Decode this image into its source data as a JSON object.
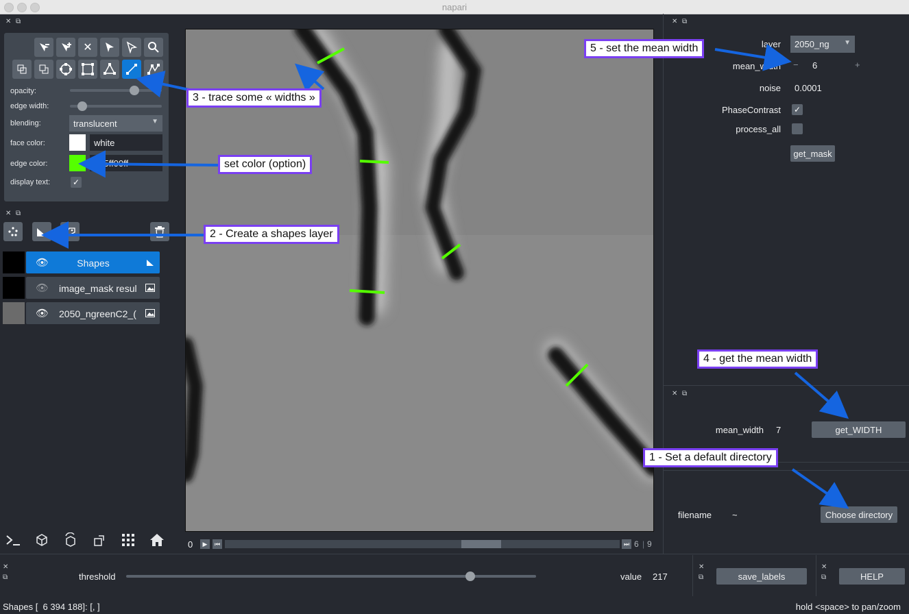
{
  "window": {
    "title": "napari"
  },
  "layer_controls": {
    "opacity_label": "opacity:",
    "edge_width_label": "edge width:",
    "blending_label": "blending:",
    "blending_value": "translucent",
    "face_color_label": "face color:",
    "face_color_value": "white",
    "edge_color_label": "edge color:",
    "edge_color_value": "#55ff00ff",
    "display_text_label": "display text:",
    "opacity": 0.7,
    "edge_width": 0.08
  },
  "layers": [
    {
      "name": "Shapes",
      "visible": true,
      "selected": true,
      "icon": "shapes-icon"
    },
    {
      "name": "image_mask resul",
      "visible": false,
      "selected": false,
      "icon": "image-icon"
    },
    {
      "name": "2050_ngreenC2_(",
      "visible": true,
      "selected": false,
      "icon": "image-icon"
    }
  ],
  "viewer": {
    "slider_start": "0",
    "slider_current": "6",
    "slider_max": "9"
  },
  "get_mask_widget": {
    "layer_label": "layer",
    "layer_value": "2050_ng",
    "mean_width_label": "mean_width",
    "mean_width_value": "6",
    "minus": "−",
    "plus": "+",
    "noise_label": "noise",
    "noise_value": "0.0001",
    "phase_label": "PhaseContrast",
    "process_all_label": "process_all",
    "button": "get_mask"
  },
  "width_widget": {
    "label": "mean_width",
    "value": "7",
    "button": "get_WIDTH"
  },
  "dir_widget": {
    "label": "filename",
    "value": "~",
    "button": "Choose directory"
  },
  "bottom": {
    "threshold_label": "threshold",
    "threshold_fraction": 0.84,
    "value_label": "value",
    "value": "217",
    "save_button": "save_labels",
    "help_button": "HELP"
  },
  "status": {
    "left": "Shapes [  6 394 188]: [, ]",
    "right": "hold <space> to pan/zoom"
  },
  "annotations": {
    "a1": "1 - Set a default directory",
    "a2": "2 - Create a shapes layer",
    "a3": "3 - trace some « widths »",
    "a4": "4 - get the mean width",
    "a5": "5 - set the mean width",
    "a6": "set color (option)"
  },
  "colors": {
    "bg": "#262930",
    "panel": "#414851",
    "accent": "#0f7ad8",
    "edge": "#55ff00",
    "annotation_border": "#7a3ff2",
    "arrow": "#1565e0"
  }
}
